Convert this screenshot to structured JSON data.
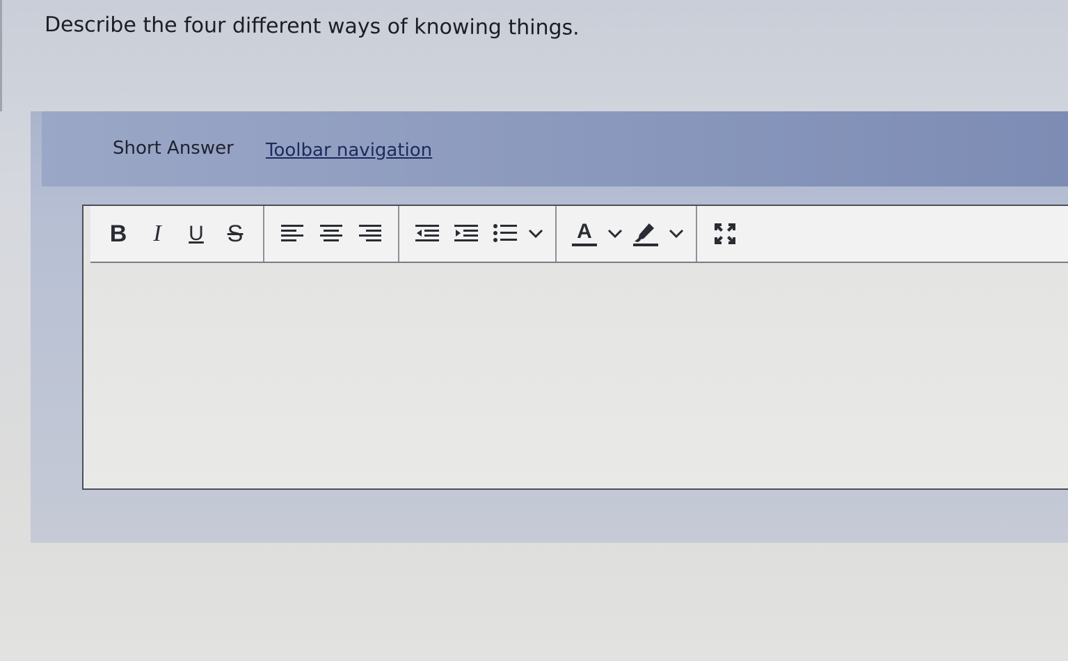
{
  "question": {
    "text": "Describe the four different ways of knowing things."
  },
  "answer_panel": {
    "title": "Short Answer",
    "toolbar_navigation_link": "Toolbar navigation"
  },
  "toolbar": {
    "groups": [
      {
        "name": "text-style",
        "buttons": [
          {
            "label": "B",
            "icon": "bold-icon"
          },
          {
            "label": "I",
            "icon": "italic-icon"
          },
          {
            "label": "U",
            "icon": "underline-icon"
          },
          {
            "label": "S",
            "icon": "strikethrough-icon"
          }
        ]
      },
      {
        "name": "alignment",
        "buttons": [
          {
            "icon": "align-left-icon"
          },
          {
            "icon": "align-center-icon"
          },
          {
            "icon": "align-right-icon"
          }
        ]
      },
      {
        "name": "indent-list",
        "buttons": [
          {
            "icon": "outdent-icon"
          },
          {
            "icon": "indent-icon"
          },
          {
            "icon": "bulleted-list-icon",
            "has_dropdown": true
          }
        ]
      },
      {
        "name": "color",
        "buttons": [
          {
            "label": "A",
            "icon": "font-color-icon",
            "has_dropdown": true
          },
          {
            "icon": "highlight-icon",
            "has_dropdown": true
          }
        ]
      },
      {
        "name": "view",
        "buttons": [
          {
            "icon": "fullscreen-icon"
          }
        ]
      }
    ]
  },
  "editor": {
    "content": ""
  },
  "colors": {
    "panel_header": "#8a98bd",
    "link": "#1d2a5e",
    "toolbar_bg": "#f2f2f2",
    "icon": "#2a2c33"
  }
}
